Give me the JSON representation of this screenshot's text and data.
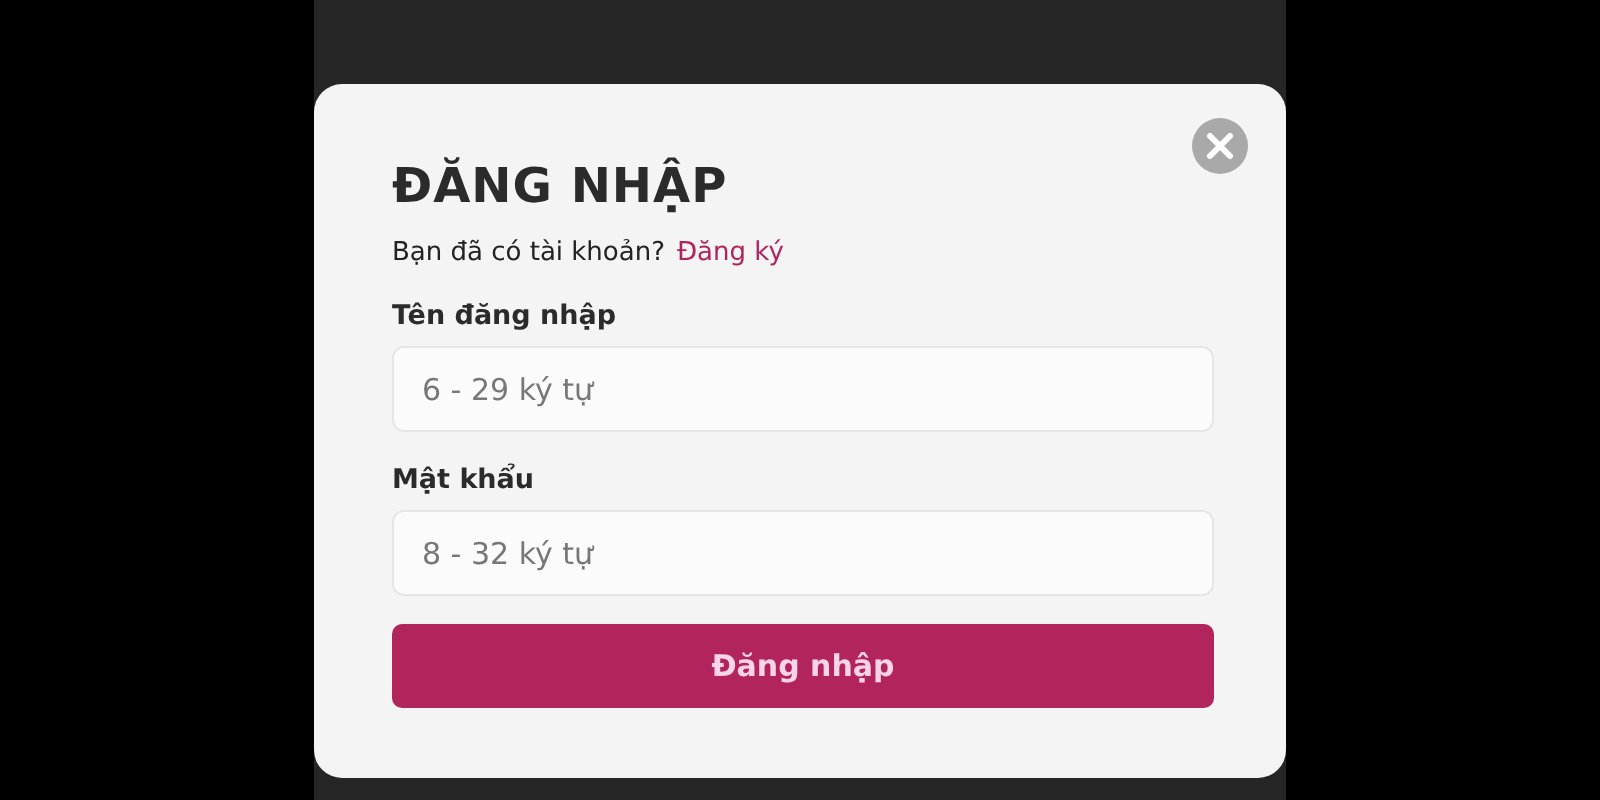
{
  "dialog": {
    "title": "ĐĂNG NHẬP",
    "prompt": "Bạn đã có tài khoản?",
    "register_link": "Đăng ký",
    "fields": [
      {
        "label": "Tên đăng nhập",
        "placeholder": "6 - 29 ký tự"
      },
      {
        "label": "Mật khẩu",
        "placeholder": "8 - 32 ký tự"
      }
    ],
    "submit": "Đăng nhập"
  }
}
